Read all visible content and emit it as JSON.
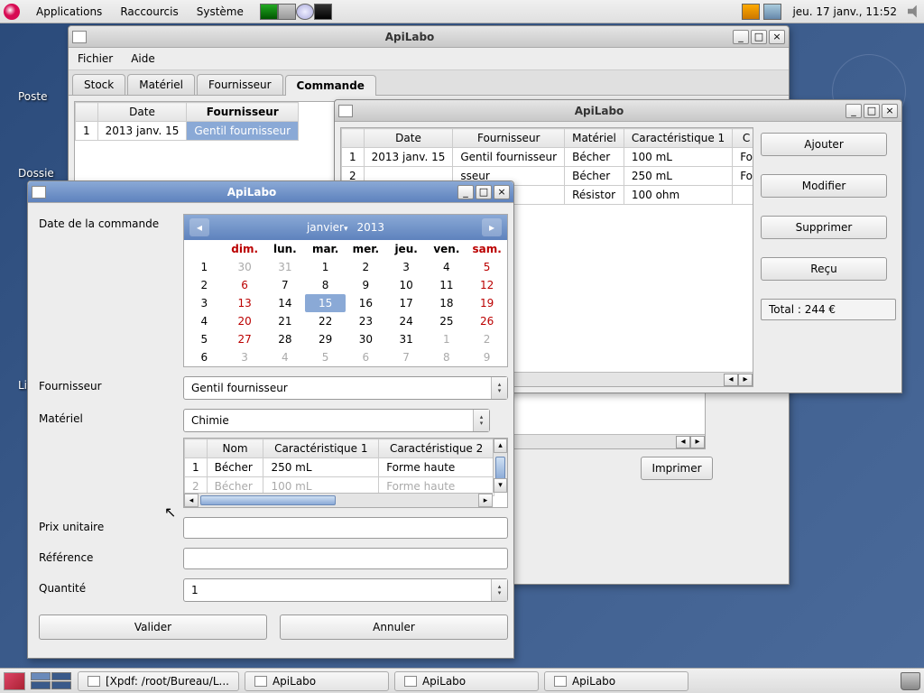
{
  "panel": {
    "menus": [
      "Applications",
      "Raccourcis",
      "Système"
    ],
    "clock": "jeu. 17 janv., 11:52"
  },
  "desktop": {
    "labels": {
      "poste": "Poste",
      "dossier": "Dossie",
      "li": "Li"
    }
  },
  "taskbar": {
    "items": [
      "[Xpdf: /root/Bureau/L...",
      "ApiLabo",
      "ApiLabo",
      "ApiLabo"
    ]
  },
  "win_main": {
    "title": "ApiLabo",
    "menu": {
      "fichier": "Fichier",
      "aide": "Aide"
    },
    "tabs": {
      "stock": "Stock",
      "materiel": "Matériel",
      "fournisseur": "Fournisseur",
      "commande": "Commande"
    },
    "table": {
      "headers": {
        "date": "Date",
        "fournisseur": "Fournisseur"
      },
      "row": {
        "idx": "1",
        "date": "2013 janv. 15",
        "fournisseur": "Gentil fournisseur"
      }
    },
    "print": "Imprimer"
  },
  "win_detail": {
    "title": "ApiLabo",
    "headers": {
      "date": "Date",
      "fournisseur": "Fournisseur",
      "materiel": "Matériel",
      "carac1": "Caractéristique 1",
      "c": "C"
    },
    "rows": [
      {
        "idx": "1",
        "date": "2013 janv. 15",
        "fournisseur": "Gentil fournisseur",
        "materiel": "Bécher",
        "carac1": "100 mL",
        "c": "Fo"
      },
      {
        "idx": "2",
        "date": "",
        "fournisseur": "sseur",
        "materiel": "Bécher",
        "carac1": "250 mL",
        "c": "Fo"
      },
      {
        "idx": "3",
        "date": "",
        "fournisseur": "sseur",
        "materiel": "Résistor",
        "carac1": "100 ohm",
        "c": ""
      }
    ],
    "buttons": {
      "ajouter": "Ajouter",
      "modifier": "Modifier",
      "supprimer": "Supprimer",
      "recu": "Reçu"
    },
    "total": "Total : 244 €"
  },
  "win_dialog": {
    "title": "ApiLabo",
    "labels": {
      "date": "Date de la commande",
      "fournisseur": "Fournisseur",
      "materiel": "Matériel",
      "prix": "Prix unitaire",
      "reference": "Référence",
      "quantite": "Quantité"
    },
    "calendar": {
      "month": "janvier",
      "year": "2013",
      "dow": [
        "dim.",
        "lun.",
        "mar.",
        "mer.",
        "jeu.",
        "ven.",
        "sam."
      ],
      "weeks": [
        {
          "wk": "1",
          "d": [
            {
              "v": "30",
              "o": 1
            },
            {
              "v": "31",
              "o": 1
            },
            {
              "v": "1"
            },
            {
              "v": "2"
            },
            {
              "v": "3"
            },
            {
              "v": "4"
            },
            {
              "v": "5",
              "we": 1
            }
          ]
        },
        {
          "wk": "2",
          "d": [
            {
              "v": "6",
              "we": 1
            },
            {
              "v": "7"
            },
            {
              "v": "8"
            },
            {
              "v": "9"
            },
            {
              "v": "10"
            },
            {
              "v": "11"
            },
            {
              "v": "12",
              "we": 1
            }
          ]
        },
        {
          "wk": "3",
          "d": [
            {
              "v": "13",
              "we": 1
            },
            {
              "v": "14"
            },
            {
              "v": "15",
              "sel": 1
            },
            {
              "v": "16"
            },
            {
              "v": "17"
            },
            {
              "v": "18"
            },
            {
              "v": "19",
              "we": 1
            }
          ]
        },
        {
          "wk": "4",
          "d": [
            {
              "v": "20",
              "we": 1
            },
            {
              "v": "21"
            },
            {
              "v": "22"
            },
            {
              "v": "23"
            },
            {
              "v": "24"
            },
            {
              "v": "25"
            },
            {
              "v": "26",
              "we": 1
            }
          ]
        },
        {
          "wk": "5",
          "d": [
            {
              "v": "27",
              "we": 1
            },
            {
              "v": "28"
            },
            {
              "v": "29"
            },
            {
              "v": "30"
            },
            {
              "v": "31"
            },
            {
              "v": "1",
              "o": 1
            },
            {
              "v": "2",
              "o": 1
            }
          ]
        },
        {
          "wk": "6",
          "d": [
            {
              "v": "3",
              "o": 1
            },
            {
              "v": "4",
              "o": 1
            },
            {
              "v": "5",
              "o": 1
            },
            {
              "v": "6",
              "o": 1
            },
            {
              "v": "7",
              "o": 1
            },
            {
              "v": "8",
              "o": 1
            },
            {
              "v": "9",
              "o": 1
            }
          ]
        }
      ]
    },
    "fournisseur_value": "Gentil fournisseur",
    "materiel_combo": "Chimie",
    "material_table": {
      "headers": {
        "nom": "Nom",
        "c1": "Caractéristique 1",
        "c2": "Caractéristique 2"
      },
      "rows": [
        {
          "idx": "1",
          "nom": "Bécher",
          "c1": "250 mL",
          "c2": "Forme haute"
        },
        {
          "idx": "2",
          "nom": "Bécher",
          "c1": "100 mL",
          "c2": "Forme haute"
        }
      ]
    },
    "quantite_value": "1",
    "buttons": {
      "valider": "Valider",
      "annuler": "Annuler"
    }
  }
}
